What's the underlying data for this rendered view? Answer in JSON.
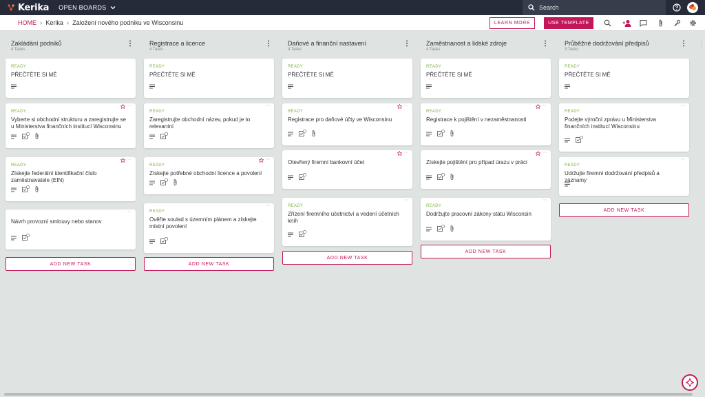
{
  "app": {
    "name": "Kerika",
    "open_boards_label": "OPEN BOARDS"
  },
  "search": {
    "placeholder": "Search"
  },
  "breadcrumb": {
    "home": "HOME",
    "org": "Kerika",
    "board": "Založení nového podniku ve Wisconsinu"
  },
  "toolbar": {
    "learn_more": "LEARN MORE",
    "use_template": "USE TEMPLATE"
  },
  "colors": {
    "accent": "#c2185b",
    "ready": "#7cb342",
    "topbar": "#252b38"
  },
  "columns": [
    {
      "title": "Zakládání podniků",
      "count": "4 Tasks",
      "cards": [
        {
          "status": "READY",
          "title": "PŘEČTĚTE SI MĚ",
          "icons": [
            "description-icon"
          ],
          "starred": false
        },
        {
          "status": "READY",
          "title": "Vyberte si obchodní strukturu a zaregistrujte se u Ministerstva finančních institucí Wisconsinu",
          "icons": [
            "description-icon",
            "checklist-icon",
            "attachment-icon"
          ],
          "starred": true
        },
        {
          "status": "READY",
          "title": "Získejte federální identifikační číslo zaměstnavatele (EIN)",
          "icons": [
            "description-icon",
            "checklist-icon",
            "attachment-icon"
          ],
          "starred": true
        },
        {
          "status": "",
          "title": "Návrh provozní smlouvy nebo stanov",
          "icons": [
            "description-icon",
            "checklist-icon"
          ],
          "starred": false
        }
      ],
      "add_label": "ADD NEW TASK"
    },
    {
      "title": "Registrace a licence",
      "count": "4 Tasks",
      "cards": [
        {
          "status": "READY",
          "title": "PŘEČTĚTE SI MĚ",
          "icons": [
            "description-icon"
          ],
          "starred": false
        },
        {
          "status": "READY",
          "title": "Zaregistrujte obchodní název, pokud je to relevantní",
          "icons": [
            "description-icon",
            "checklist-icon"
          ],
          "starred": false
        },
        {
          "status": "READY",
          "title": "Získejte potřebné obchodní licence a povolení",
          "icons": [
            "description-icon",
            "checklist-icon",
            "attachment-icon"
          ],
          "starred": true
        },
        {
          "status": "READY",
          "title": "Ověřte soulad s územním plánem a získejte místní povolení",
          "icons": [
            "description-icon",
            "checklist-icon"
          ],
          "starred": false
        }
      ],
      "add_label": "ADD NEW TASK"
    },
    {
      "title": "Daňové a finanční nastavení",
      "count": "4 Tasks",
      "cards": [
        {
          "status": "READY",
          "title": "PŘEČTĚTE SI MĚ",
          "icons": [
            "description-icon"
          ],
          "starred": false
        },
        {
          "status": "READY",
          "title": "Registrace pro daňové účty ve Wisconsinu",
          "icons": [
            "description-icon",
            "checklist-icon",
            "attachment-icon"
          ],
          "starred": true
        },
        {
          "status": "",
          "title": "Otevřený firemní bankovní účet",
          "icons": [
            "description-icon",
            "checklist-icon"
          ],
          "starred": true
        },
        {
          "status": "READY",
          "title": "Zřízení firemního účetnictví a vedení účetních knih",
          "icons": [
            "description-icon",
            "checklist-icon"
          ],
          "starred": false
        }
      ],
      "add_label": "ADD NEW TASK"
    },
    {
      "title": "Zaměstnanost a lidské zdroje",
      "count": "4 Tasks",
      "cards": [
        {
          "status": "READY",
          "title": "PŘEČTĚTE SI MĚ",
          "icons": [
            "description-icon"
          ],
          "starred": false
        },
        {
          "status": "READY",
          "title": "Registrace k pojištění v nezaměstnanosti",
          "icons": [
            "description-icon",
            "checklist-icon",
            "attachment-icon"
          ],
          "starred": true
        },
        {
          "status": "",
          "title": "Získejte pojištění pro případ úrazu v práci",
          "icons": [
            "description-icon",
            "checklist-icon",
            "attachment-icon"
          ],
          "starred": true
        },
        {
          "status": "READY",
          "title": "Dodržujte pracovní zákony státu Wisconsin",
          "icons": [
            "description-icon",
            "checklist-icon",
            "attachment-icon"
          ],
          "starred": false
        }
      ],
      "add_label": "ADD NEW TASK"
    },
    {
      "title": "Průběžné dodržování předpisů",
      "count": "3 Tasks",
      "cards": [
        {
          "status": "READY",
          "title": "PŘEČTĚTE SI MĚ",
          "icons": [
            "description-icon"
          ],
          "starred": false
        },
        {
          "status": "READY",
          "title": "Podejte výroční zprávu u Ministerstva finančních institucí Wisconsinu",
          "icons": [
            "description-icon",
            "checklist-icon"
          ],
          "starred": false
        },
        {
          "status": "READY",
          "title": "Udržujte firemní dodržování předpisů a záznamy",
          "icons": [
            "description-icon"
          ],
          "starred": false
        }
      ],
      "add_label": "ADD NEW TASK"
    }
  ]
}
